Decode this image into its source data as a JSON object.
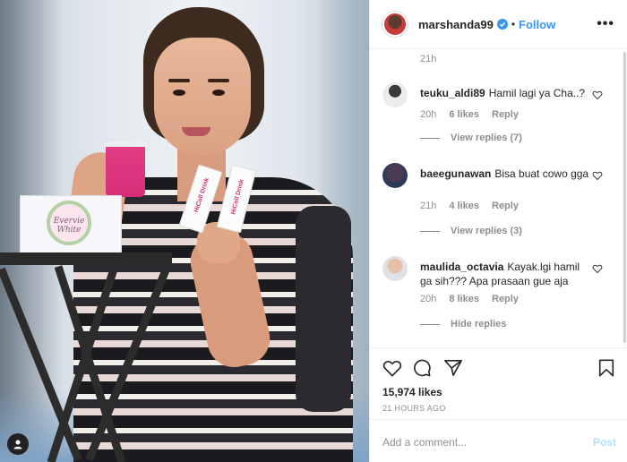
{
  "post": {
    "username": "marshanda99",
    "dot": "•",
    "follow_label": "Follow",
    "more_label": "•••",
    "box_label": "Evervie White",
    "stick_label": "HiColl Drink"
  },
  "comments": {
    "top_time": "21h",
    "items": [
      {
        "user": "teuku_aldi89",
        "text": "Hamil lagi ya Cha..?",
        "time": "20h",
        "likes": "6 likes",
        "reply_label": "Reply",
        "replies_label": "View replies (7)"
      },
      {
        "user": "baeegunawan",
        "text": "Bisa buat cowo gga",
        "time": "21h",
        "likes": "4 likes",
        "reply_label": "Reply",
        "replies_label": "View replies (3)"
      },
      {
        "user": "maulida_octavia",
        "text": "Kayak.lgi hamil ga sih??? Apa prasaan gue aja",
        "time": "20h",
        "likes": "8 likes",
        "reply_label": "Reply",
        "replies_label": "Hide replies"
      }
    ]
  },
  "actions": {
    "likes_count": "15,974 likes",
    "posted_ago": "21 HOURS AGO"
  },
  "composer": {
    "placeholder": "Add a comment...",
    "post_label": "Post"
  },
  "colors": {
    "accent": "#3897f0",
    "muted": "#8e8e8e",
    "post_disabled": "#b2dffc"
  }
}
